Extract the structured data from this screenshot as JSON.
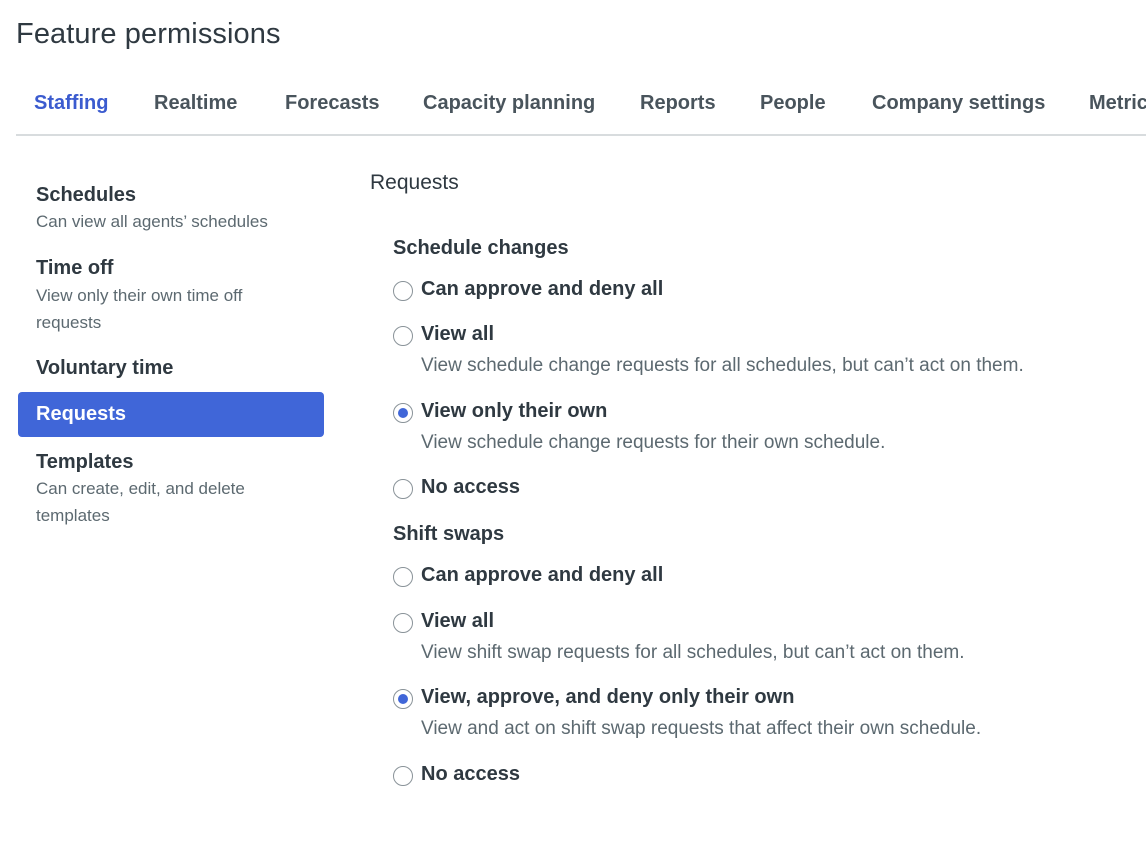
{
  "page": {
    "title": "Feature permissions"
  },
  "tabs": [
    {
      "label": "Staffing",
      "active": true
    },
    {
      "label": "Realtime"
    },
    {
      "label": "Forecasts"
    },
    {
      "label": "Capacity planning"
    },
    {
      "label": "Reports"
    },
    {
      "label": "People"
    },
    {
      "label": "Company settings"
    },
    {
      "label": "Metrics"
    }
  ],
  "sidebar": {
    "items": [
      {
        "label": "Schedules",
        "desc": "Can view all agents’ schedules"
      },
      {
        "label": "Time off",
        "desc": "View only their own time off requests"
      },
      {
        "label": "Voluntary time"
      },
      {
        "label": "Requests",
        "active": true
      },
      {
        "label": "Templates",
        "desc": "Can create, edit, and delete templates"
      }
    ]
  },
  "main": {
    "section_title": "Requests",
    "schedule_changes": {
      "title": "Schedule changes",
      "options": [
        {
          "label": "Can approve and deny all"
        },
        {
          "label": "View all",
          "desc": "View schedule change requests for all schedules, but can’t act on them."
        },
        {
          "label": "View only their own",
          "desc": "View schedule change requests for their own schedule.",
          "selected": true
        },
        {
          "label": "No access"
        }
      ]
    },
    "shift_swaps": {
      "title": "Shift swaps",
      "options": [
        {
          "label": "Can approve and deny all"
        },
        {
          "label": "View all",
          "desc": "View shift swap requests for all schedules, but can’t act on them."
        },
        {
          "label": "View, approve, and deny only their own",
          "desc": "View and act on shift swap requests that affect their own schedule.",
          "selected": true
        },
        {
          "label": "No access"
        }
      ]
    }
  }
}
